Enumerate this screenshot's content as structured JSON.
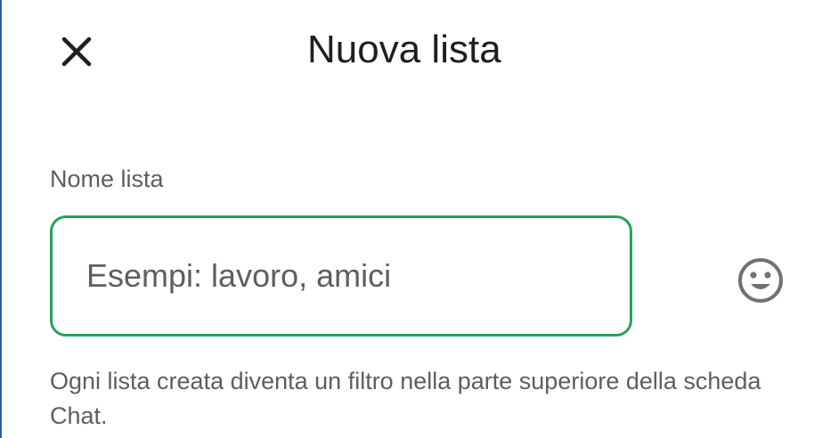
{
  "header": {
    "title": "Nuova lista",
    "close_icon": "close-icon"
  },
  "form": {
    "label": "Nome lista",
    "input_value": "",
    "input_placeholder": "Esempi: lavoro, amici",
    "emoji_icon": "smiley-icon",
    "help_text": "Ogni lista creata diventa un filtro nella parte superiore della scheda Chat."
  },
  "colors": {
    "accent": "#25a35a",
    "title_text": "#1f1f1f",
    "secondary_text": "#5b5f62"
  }
}
